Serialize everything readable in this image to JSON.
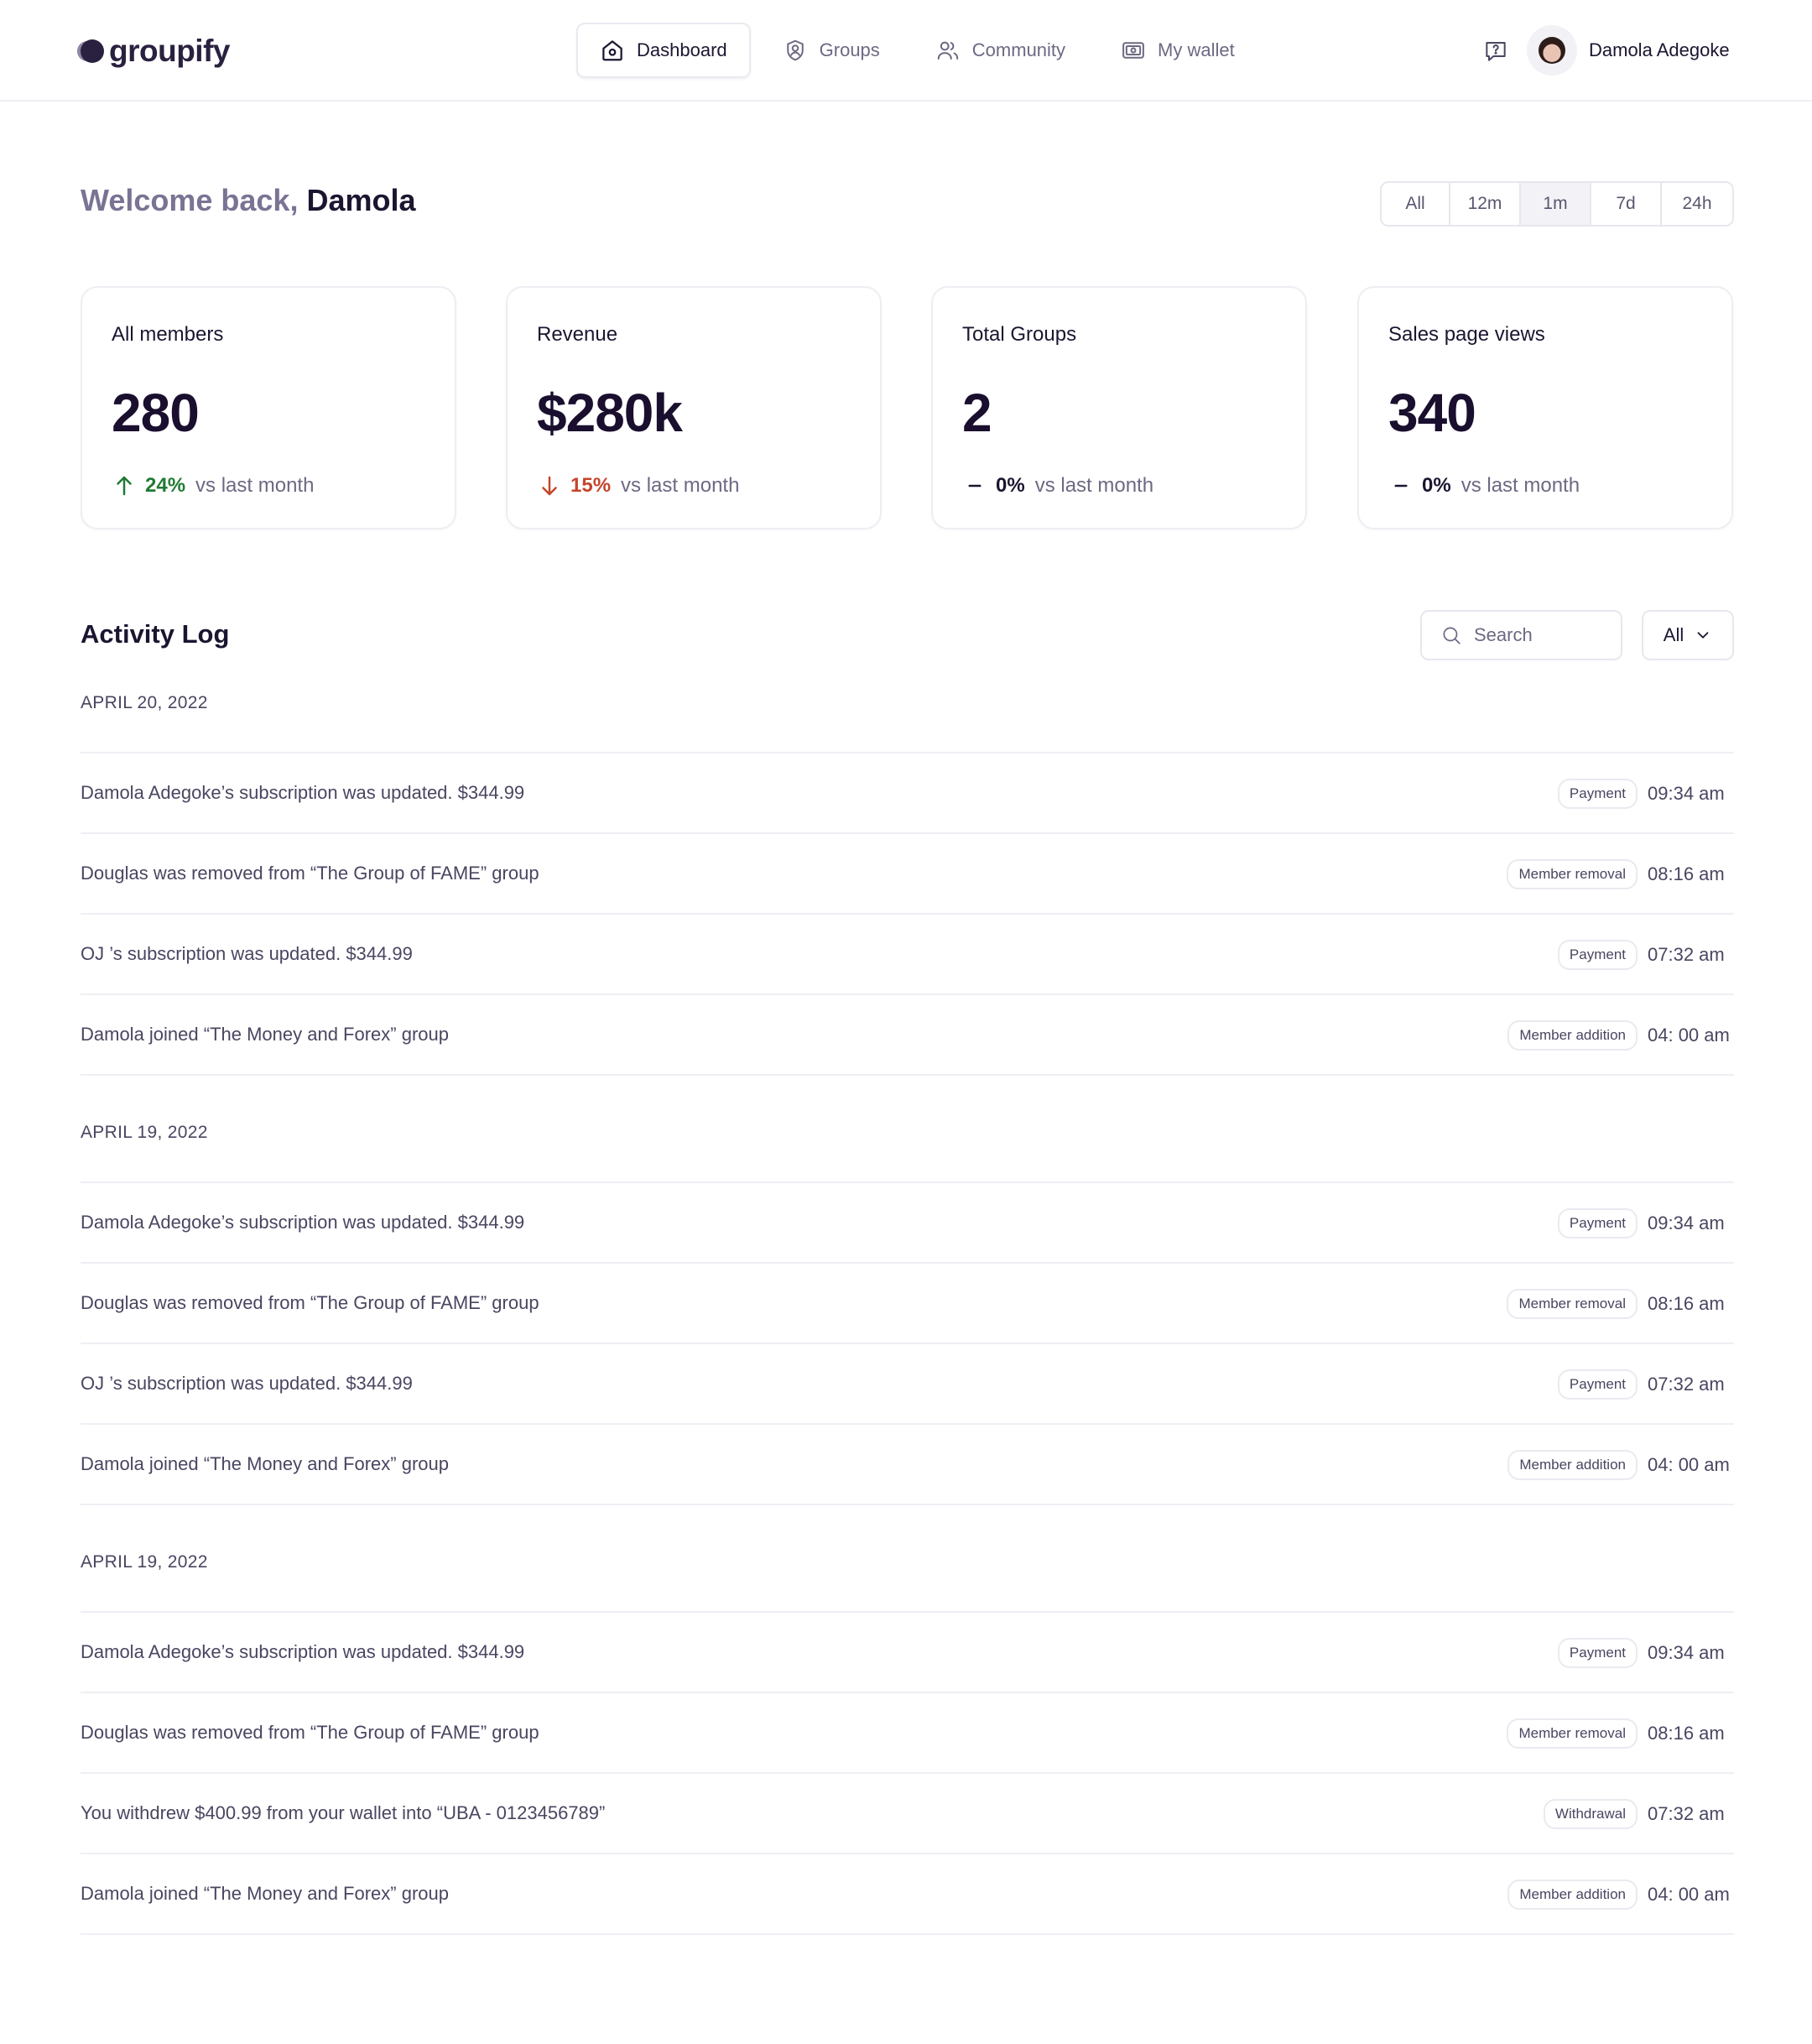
{
  "brand": {
    "name": "groupify"
  },
  "nav": [
    {
      "label": "Dashboard",
      "icon": "home-icon",
      "active": true
    },
    {
      "label": "Groups",
      "icon": "user-circle-icon",
      "active": false
    },
    {
      "label": "Community",
      "icon": "users-icon",
      "active": false
    },
    {
      "label": "My wallet",
      "icon": "wallet-icon",
      "active": false
    }
  ],
  "header": {
    "help_icon": "help-message-icon",
    "user_name": "Damola Adegoke"
  },
  "welcome": {
    "prefix": "Welcome back, ",
    "name": "Damola"
  },
  "time_range": {
    "options": [
      "All",
      "12m",
      "1m",
      "7d",
      "24h"
    ],
    "selected": "1m"
  },
  "stats": [
    {
      "label": "All members",
      "value": "280",
      "trend": "up",
      "pct": "24%",
      "suffix": "vs last month"
    },
    {
      "label": "Revenue",
      "value": "$280k",
      "trend": "down",
      "pct": "15%",
      "suffix": "vs last month"
    },
    {
      "label": "Total Groups",
      "value": "2",
      "trend": "flat",
      "pct": "0%",
      "suffix": "vs last month"
    },
    {
      "label": "Sales page views",
      "value": "340",
      "trend": "flat",
      "pct": "0%",
      "suffix": "vs last month"
    }
  ],
  "colors": {
    "up": "#217a33",
    "down": "#c4452b",
    "text_dark": "#1c1530",
    "text_muted": "#6e6883"
  },
  "activity": {
    "title": "Activity Log",
    "search_placeholder": "Search",
    "filter_value": "All",
    "groups": [
      {
        "date": "APRIL 20, 2022",
        "items": [
          {
            "text": "Damola Adegoke’s subscription was updated. $344.99",
            "tag": "Payment",
            "time": "09:34 am"
          },
          {
            "text": "Douglas was removed from “The Group of FAME” group",
            "tag": "Member removal",
            "time": "08:16 am"
          },
          {
            "text": "OJ ’s subscription was updated. $344.99",
            "tag": "Payment",
            "time": "07:32 am"
          },
          {
            "text": "Damola joined “The Money and Forex” group",
            "tag": "Member addition",
            "time": "04: 00 am"
          }
        ]
      },
      {
        "date": "APRIL 19, 2022",
        "items": [
          {
            "text": "Damola Adegoke’s subscription was updated. $344.99",
            "tag": "Payment",
            "time": "09:34 am"
          },
          {
            "text": "Douglas was removed from “The Group of FAME” group",
            "tag": "Member removal",
            "time": "08:16 am"
          },
          {
            "text": "OJ ’s subscription was updated. $344.99",
            "tag": "Payment",
            "time": "07:32 am"
          },
          {
            "text": "Damola joined “The Money and Forex” group",
            "tag": "Member addition",
            "time": "04: 00 am"
          }
        ]
      },
      {
        "date": "APRIL 19, 2022",
        "items": [
          {
            "text": "Damola Adegoke’s subscription was updated. $344.99",
            "tag": "Payment",
            "time": "09:34 am"
          },
          {
            "text": "Douglas was removed from “The Group of FAME” group",
            "tag": "Member removal",
            "time": "08:16 am"
          },
          {
            "text": "You withdrew $400.99 from your wallet into “UBA - 0123456789”",
            "tag": "Withdrawal",
            "time": "07:32 am"
          },
          {
            "text": "Damola joined “The Money and Forex” group",
            "tag": "Member addition",
            "time": "04: 00 am"
          }
        ]
      }
    ]
  }
}
